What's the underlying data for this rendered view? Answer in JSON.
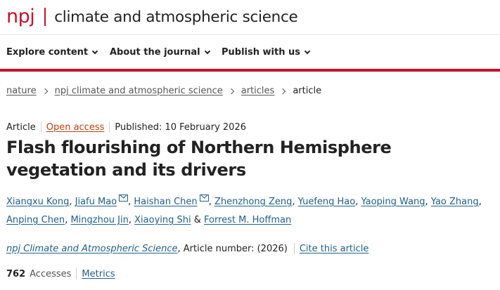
{
  "header": {
    "logo_npj": "npj",
    "journal_title": "climate and atmospheric science"
  },
  "nav": {
    "items": [
      {
        "label": "Explore content"
      },
      {
        "label": "About the journal"
      },
      {
        "label": "Publish with us"
      }
    ]
  },
  "breadcrumb": {
    "items": [
      "nature",
      "npj climate and atmospheric science",
      "articles",
      "article"
    ]
  },
  "article": {
    "type": "Article",
    "access": "Open access",
    "published": "Published: 10 February 2026",
    "title": "Flash flourishing of Northern Hemisphere vegetation and its drivers",
    "authors": [
      {
        "name": "Xiangxu Kong",
        "mail": false
      },
      {
        "name": "Jiafu Mao",
        "mail": true
      },
      {
        "name": "Haishan Chen",
        "mail": true
      },
      {
        "name": "Zhenzhong Zeng",
        "mail": false
      },
      {
        "name": "Yuefeng Hao",
        "mail": false
      },
      {
        "name": "Yaoping Wang",
        "mail": false
      },
      {
        "name": "Yao Zhang",
        "mail": false
      },
      {
        "name": "Anping Chen",
        "mail": false
      },
      {
        "name": "Mingzhou Jin",
        "mail": false
      },
      {
        "name": "Xiaoying Shi",
        "mail": false
      },
      {
        "name": "Forrest M. Hoffman",
        "mail": false
      }
    ],
    "ampersand": "&",
    "journal": "npj Climate and Atmospheric Science",
    "article_number": ", Article number:  (2026)",
    "cite_link": "Cite this article",
    "accesses_count": "762",
    "accesses_label": "Accesses",
    "metrics_link": "Metrics"
  },
  "colors": {
    "brand_red": "#c8102e",
    "link_blue": "#1f5f8b",
    "open_access_orange": "#c2410c"
  }
}
